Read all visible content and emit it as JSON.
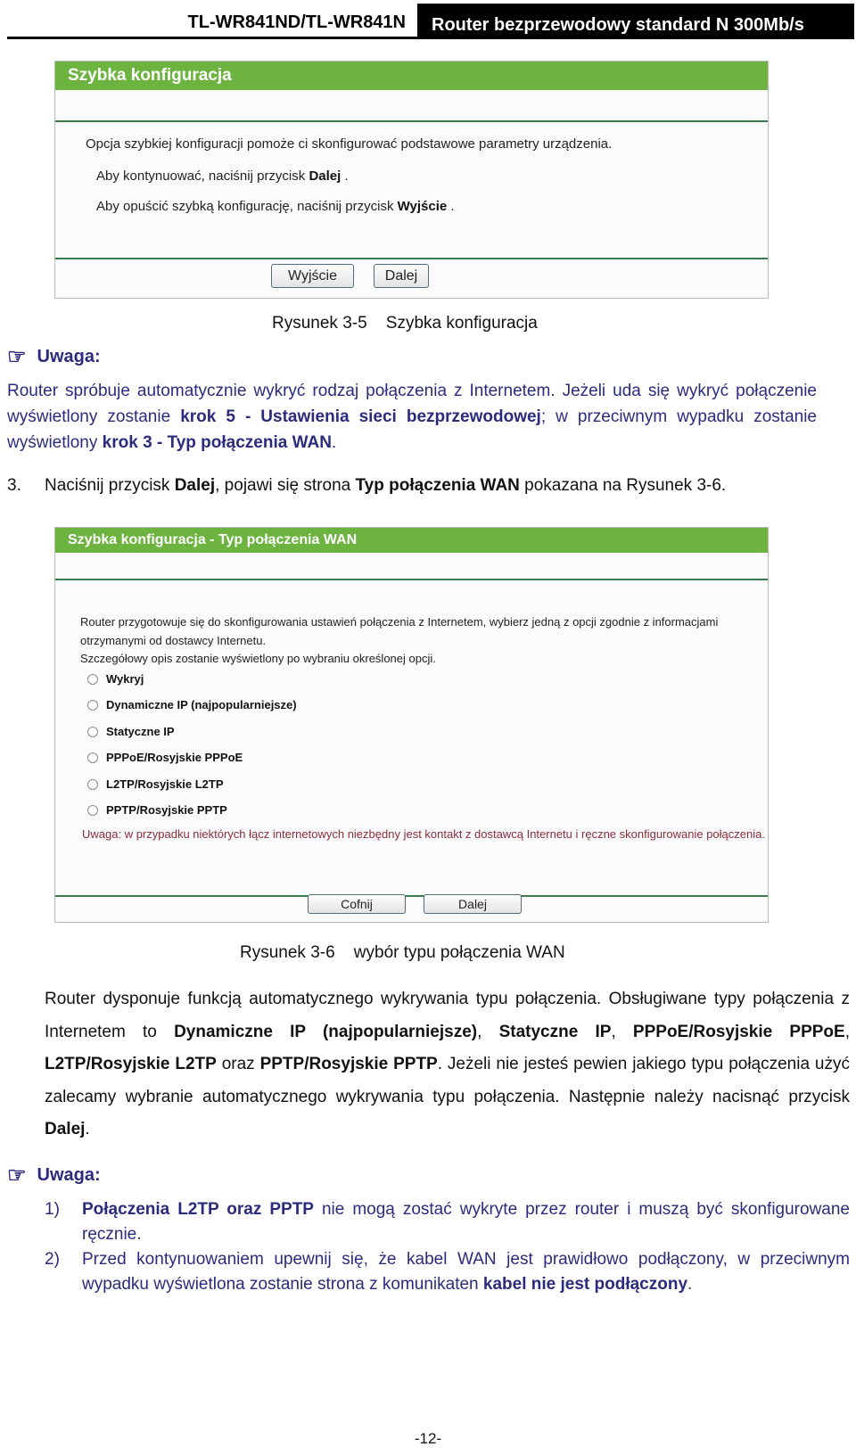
{
  "header": {
    "model": "TL-WR841ND/TL-WR841N",
    "product": "Router bezprzewodowy standard N 300Mb/s"
  },
  "figure1": {
    "title": "Szybka konfiguracja",
    "line1": "Opcja szybkiej konfiguracji pomoże ci skonfigurować podstawowe parametry urządzenia.",
    "line2_prefix": "Aby kontynuować, naciśnij przycisk ",
    "line2_bold": "Dalej",
    "line2_suffix": " .",
    "line3_prefix": "Aby opuścić szybką konfigurację, naciśnij przycisk ",
    "line3_bold": "Wyjście",
    "line3_suffix": " .",
    "buttons": {
      "exit": "Wyjście",
      "next": "Dalej"
    },
    "caption": "Rysunek 3-5    Szybka konfiguracja"
  },
  "note1": {
    "heading": "Uwaga:",
    "icon": "pointing-hand-icon",
    "p1": "Router spróbuje automatycznie wykryć rodzaj połączenia z Internetem. Jeżeli uda się wykryć połączenie wyświetlony zostanie ",
    "b1": "krok 5 - Ustawienia sieci bezprzewodowej",
    "p2": "; w przeciwnym wypadku zostanie wyświetlony ",
    "b2": "krok 3 - Typ połączenia WAN",
    "p3": "."
  },
  "step3": {
    "num": "3.",
    "t1": "Naciśnij przycisk ",
    "b1": "Dalej",
    "t2": ", pojawi się strona ",
    "b2": "Typ połączenia WAN",
    "t3": " pokazana na Rysunek 3-6."
  },
  "figure2": {
    "title": "Szybka konfiguracja - Typ połączenia WAN",
    "intro1": "Router przygotowuje się do skonfigurowania ustawień połączenia z Internetem, wybierz jedną z opcji zgodnie z informacjami",
    "intro2": "otrzymanymi od dostawcy Internetu.",
    "intro3": "Szczegółowy opis zostanie wyświetlony po wybraniu określonej opcji.",
    "options": [
      {
        "label": "Wykryj",
        "selected": false
      },
      {
        "label": "Dynamiczne IP (najpopularniejsze)",
        "selected": false
      },
      {
        "label": "Statyczne IP",
        "selected": false
      },
      {
        "label": "PPPoE/Rosyjskie PPPoE",
        "selected": false
      },
      {
        "label": "L2TP/Rosyjskie L2TP",
        "selected": false
      },
      {
        "label": "PPTP/Rosyjskie PPTP",
        "selected": false
      }
    ],
    "warning": "Uwaga: w przypadku niektórych łącz internetowych niezbędny jest kontakt z dostawcą Internetu i ręczne skonfigurowanie połączenia.",
    "buttons": {
      "back": "Cofnij",
      "next": "Dalej"
    },
    "caption": "Rysunek 3-6    wybór typu połączenia WAN"
  },
  "para2": {
    "t1": "Router dysponuje funkcją automatycznego wykrywania typu połączenia. Obsługiwane typy połączenia z Internetem to ",
    "b1": "Dynamiczne IP (najpopularniejsze)",
    "t2": ", ",
    "b2": "Statyczne IP",
    "t3": ", ",
    "b3": "PPPoE/Rosyjskie PPPoE",
    "t4": ", ",
    "b4": "L2TP/Rosyjskie L2TP",
    "t5": " oraz ",
    "b5": "PPTP/Rosyjskie PPTP",
    "t6": ". Jeżeli nie jesteś pewien jakiego typu połączenia użyć zalecamy wybranie automatycznego wykrywania typu połączenia. Następnie należy nacisnąć przycisk ",
    "b6": "Dalej",
    "t7": "."
  },
  "note2": {
    "heading": "Uwaga:",
    "items": [
      {
        "num": "1)",
        "bold": "Połączenia L2TP oraz PPTP",
        "text": " nie mogą zostać wykryte przez router i muszą być skonfigurowane ręcznie."
      },
      {
        "num": "2)",
        "text": "Przed kontynuowaniem upewnij się, że kabel WAN jest prawidłowo podłączony, w przeciwnym wypadku wyświetlona zostanie strona z komunikaten ",
        "bold": "kabel nie jest podłączony",
        "suffix": "."
      }
    ]
  },
  "page_number": "-12-"
}
